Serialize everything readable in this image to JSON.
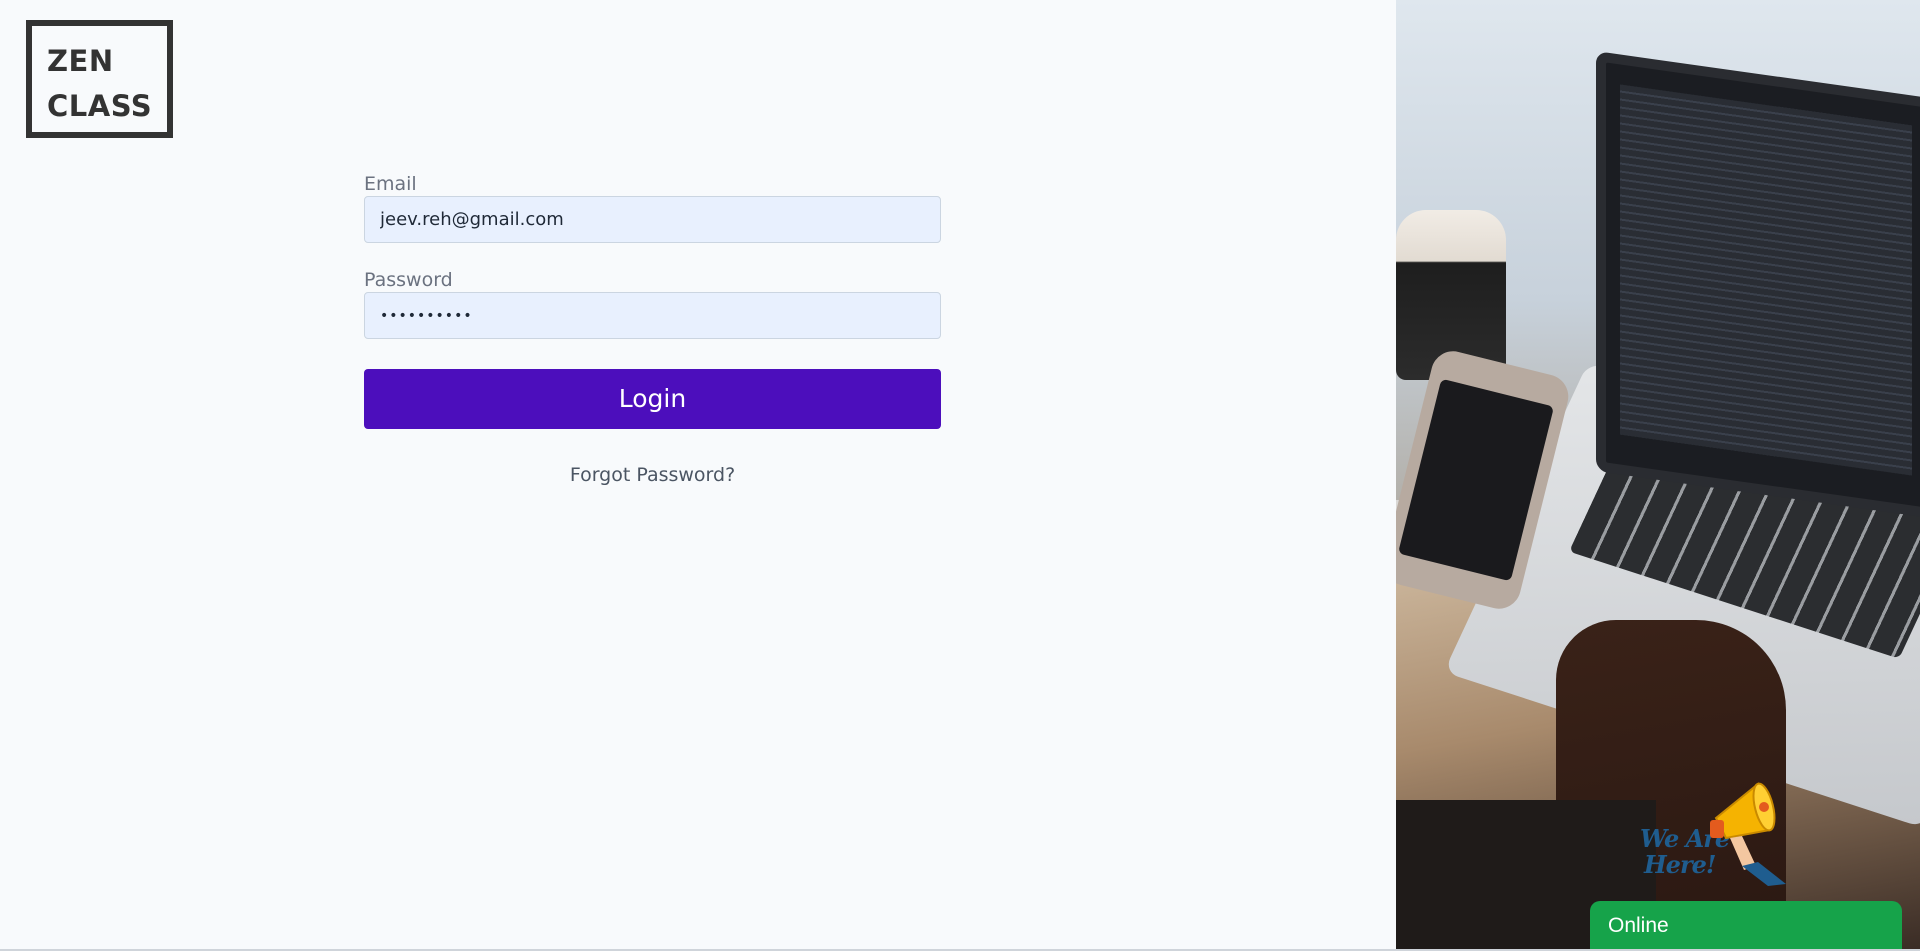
{
  "brand": {
    "logo_line1": "ZEN",
    "logo_line2": "CLASS"
  },
  "login_form": {
    "email_label": "Email",
    "email_value": "jeev.reh@gmail.com",
    "password_label": "Password",
    "password_value": "••••••••••",
    "login_button_label": "Login",
    "forgot_password_label": "Forgot Password?"
  },
  "widget": {
    "tagline_line1": "We Are",
    "tagline_line2": "Here!",
    "status_label": "Online",
    "status_color": "#16a34a"
  },
  "colors": {
    "primary_button": "#4c0ebc",
    "input_background": "#e8f0fe",
    "page_background": "#f8fafc"
  },
  "icons": {
    "megaphone": "megaphone-icon"
  }
}
